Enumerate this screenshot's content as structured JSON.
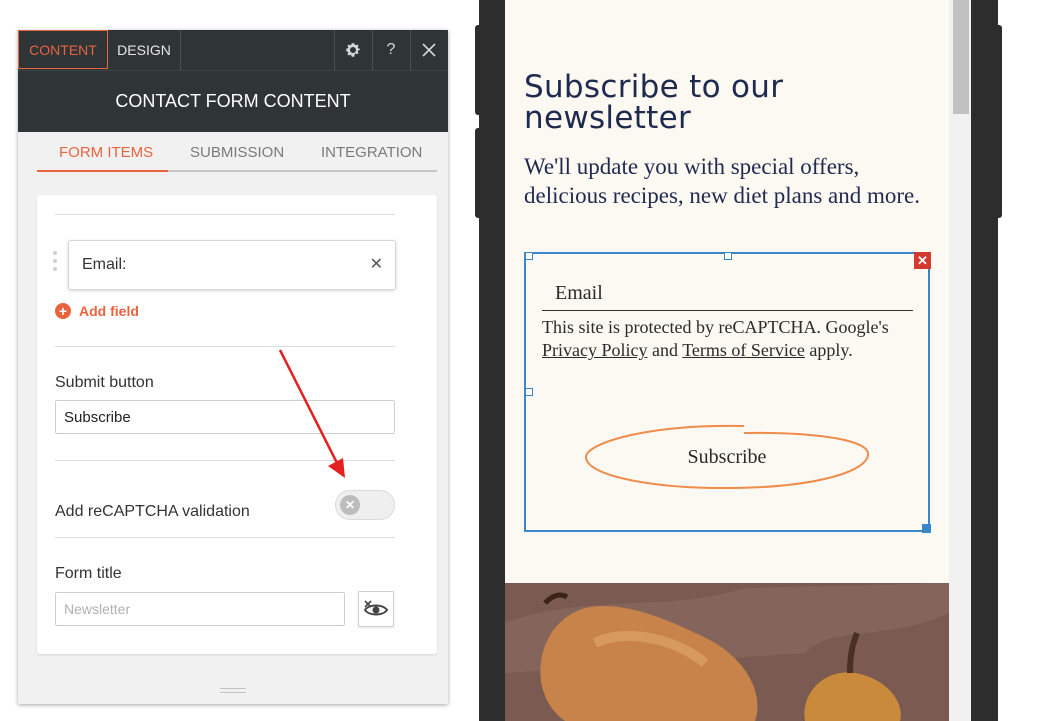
{
  "panel": {
    "tabs": {
      "content": "CONTENT",
      "design": "DESIGN"
    },
    "help_label": "?",
    "header_title": "CONTACT FORM CONTENT",
    "subtabs": [
      "FORM ITEMS",
      "SUBMISSION",
      "INTEGRATION"
    ],
    "field_label": "Email:",
    "add_field_label": "Add field",
    "submit_button_label": "Submit button",
    "submit_button_value": "Subscribe",
    "recaptcha_label": "Add reCAPTCHA validation",
    "recaptcha_enabled": false,
    "form_title_label": "Form title",
    "form_title_placeholder": "Newsletter",
    "accent_color": "#e8643f"
  },
  "preview": {
    "title": "Subscribe to our newsletter",
    "subtitle": "We'll update you with special offers, delicious recipes, new diet plans and more.",
    "email_placeholder": "Email",
    "recaptcha_text_1": "This site is protected by reCAPTCHA. Google's",
    "privacy_link": "Privacy Policy",
    "and_text": "and",
    "terms_link": "Terms of Service",
    "apply_text": "apply.",
    "subscribe_button": "Subscribe",
    "selection_color": "#3a86c9"
  }
}
